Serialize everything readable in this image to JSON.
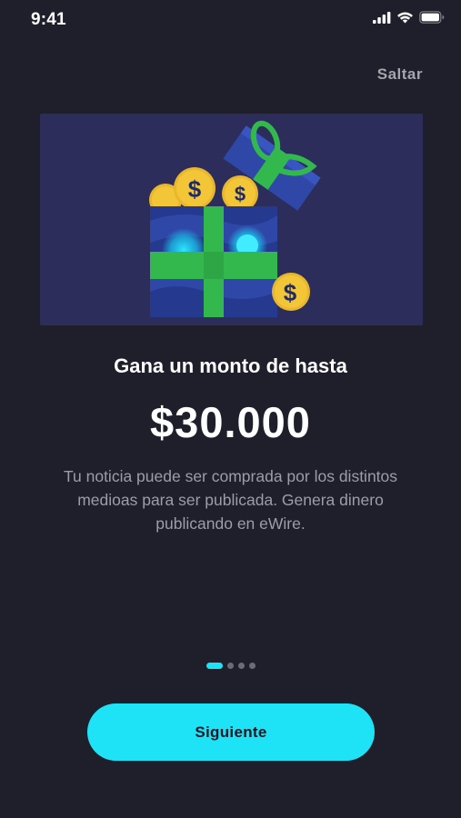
{
  "status_bar": {
    "time": "9:41"
  },
  "header": {
    "skip_label": "Saltar"
  },
  "hero": {
    "illustration": "gift-box-with-coins",
    "coin_symbol": "$"
  },
  "content": {
    "headline": "Gana un monto de hasta",
    "amount": "$30.000",
    "description": "Tu noticia puede ser comprada por los distintos medioas para ser publicada. Genera dinero publicando en eWire."
  },
  "pager": {
    "current": 1,
    "total": 4
  },
  "footer": {
    "next_label": "Siguiente"
  },
  "colors": {
    "background": "#1f1e2b",
    "accent": "#1ee3f7",
    "hero_background": "#2c2d5a",
    "gift_ribbon": "#2fb24a",
    "coin": "#f2c636"
  }
}
